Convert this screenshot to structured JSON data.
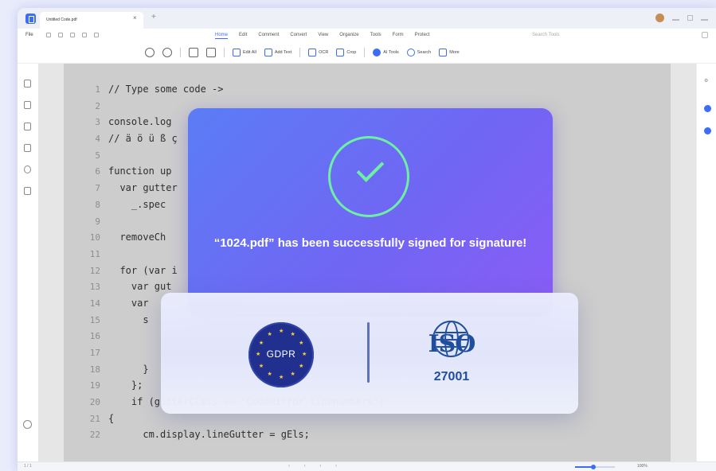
{
  "window": {
    "tab_title": "Untitled Code.pdf"
  },
  "menu": {
    "file_label": "File",
    "tabs": [
      "Home",
      "Edit",
      "Comment",
      "Convert",
      "View",
      "Organize",
      "Tools",
      "Form",
      "Protect"
    ],
    "active_tab": "Home",
    "search_placeholder": "Search Tools"
  },
  "toolbar": {
    "edit_all": "Edit All",
    "add_text": "Add Text",
    "ocr": "OCR",
    "crop": "Crop",
    "ai_tools": "AI Tools",
    "search": "Search",
    "more": "More"
  },
  "code": {
    "lines": [
      {
        "n": "1",
        "text": "// Type some code ->"
      },
      {
        "n": "2",
        "text": ""
      },
      {
        "n": "3",
        "text": "console.log"
      },
      {
        "n": "4",
        "text": "// ä ö ü ß ç"
      },
      {
        "n": "5",
        "text": ""
      },
      {
        "n": "6",
        "text": "function up"
      },
      {
        "n": "7",
        "text": "  var gutter"
      },
      {
        "n": "8",
        "text": "    _.spec"
      },
      {
        "n": "9",
        "text": ""
      },
      {
        "n": "10",
        "text": "  removeCh"
      },
      {
        "n": "11",
        "text": ""
      },
      {
        "n": "12",
        "text": "  for (var i"
      },
      {
        "n": "13",
        "text": "    var gut"
      },
      {
        "n": "14",
        "text": "    var"
      },
      {
        "n": "15",
        "text": "      s"
      },
      {
        "n": "16",
        "text": ""
      },
      {
        "n": "17",
        "text": ""
      },
      {
        "n": "18",
        "text": "      }"
      },
      {
        "n": "19",
        "text": "    };"
      },
      {
        "n": "20",
        "text": "    if (gutterClass == \"CodeMirror-linenumbers\")"
      },
      {
        "n": "21",
        "text": "{"
      },
      {
        "n": "22",
        "text": "      cm.display.lineGutter = gEls;"
      }
    ]
  },
  "dialog": {
    "message": "“1024.pdf” has been successfully signed for signature!",
    "check_color": "#6ef0a2",
    "gradient_start": "#5b7df5",
    "gradient_end": "#8a5cf6"
  },
  "certs": {
    "gdpr_label": "GDPR",
    "iso_label": "ISO",
    "iso_code": "27001",
    "iso_color": "#1f4e9c",
    "gdpr_color": "#21308f"
  },
  "status": {
    "page_info": "1 / 1",
    "zoom_value": "100%",
    "zoom_fraction": 0.45
  }
}
